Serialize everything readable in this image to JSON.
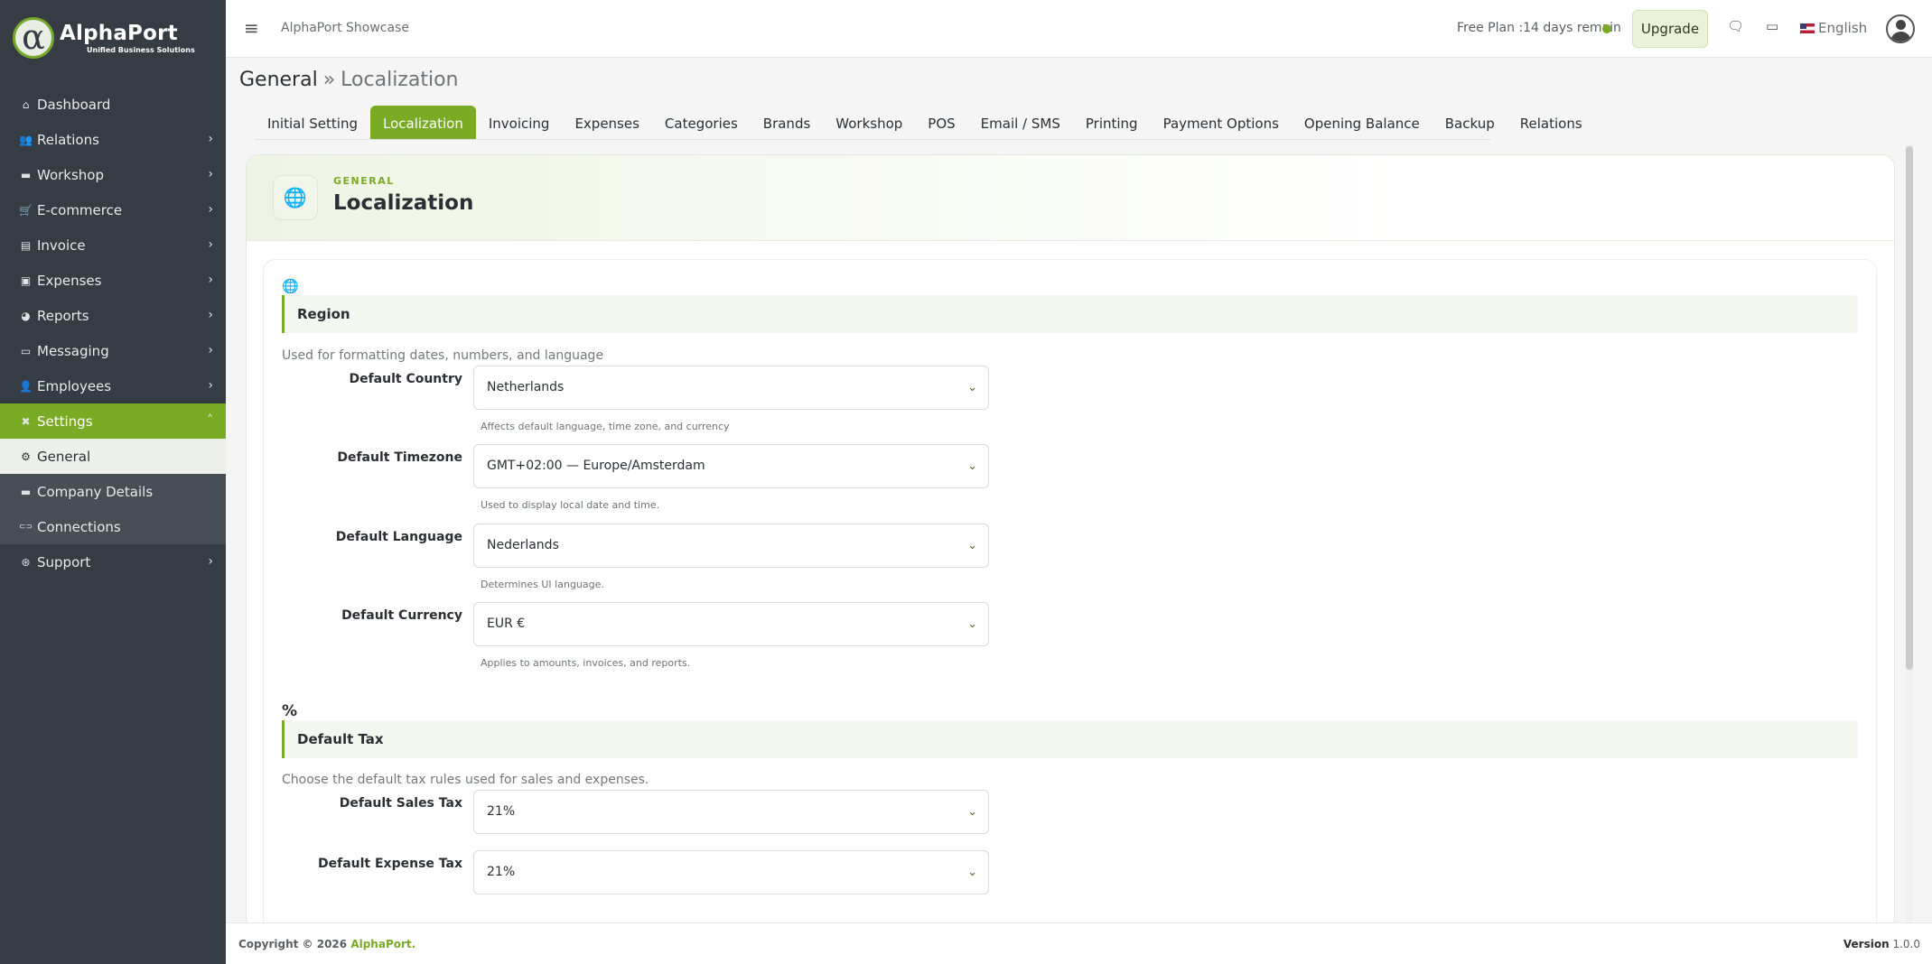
{
  "brand": {
    "title": "AlphaPort",
    "subtitle": "Unified Business Solutions",
    "mark": "α"
  },
  "sidebar": {
    "items": [
      {
        "label": "Dashboard",
        "icon": "home-icon",
        "glyph": "⌂",
        "chev": ""
      },
      {
        "label": "Relations",
        "icon": "users-icon",
        "glyph": "👥",
        "chev": "›"
      },
      {
        "label": "Workshop",
        "icon": "briefcase-icon",
        "glyph": "▬",
        "chev": "›"
      },
      {
        "label": "E-commerce",
        "icon": "cart-icon",
        "glyph": "🛒",
        "chev": "›"
      },
      {
        "label": "Invoice",
        "icon": "invoice-icon",
        "glyph": "▤",
        "chev": "›"
      },
      {
        "label": "Expenses",
        "icon": "money-icon",
        "glyph": "▣",
        "chev": "›"
      },
      {
        "label": "Reports",
        "icon": "pie-chart-icon",
        "glyph": "◕",
        "chev": "›"
      },
      {
        "label": "Messaging",
        "icon": "message-icon",
        "glyph": "▭",
        "chev": "›"
      },
      {
        "label": "Employees",
        "icon": "employees-icon",
        "glyph": "👤",
        "chev": "›"
      },
      {
        "label": "Settings",
        "icon": "tools-icon",
        "glyph": "✖",
        "chev": "˄"
      },
      {
        "label": "General",
        "icon": "gear-icon",
        "glyph": "⚙",
        "chev": ""
      },
      {
        "label": "Company Details",
        "icon": "briefcase-icon",
        "glyph": "▬",
        "chev": ""
      },
      {
        "label": "Connections",
        "icon": "link-icon",
        "glyph": "⊂⊃",
        "chev": ""
      },
      {
        "label": "Support",
        "icon": "lifebuoy-icon",
        "glyph": "⊛",
        "chev": "›"
      }
    ]
  },
  "header": {
    "app_name": "AlphaPort Showcase",
    "plan": "Free Plan :14 days remain",
    "upgrade": "Upgrade",
    "language": "English",
    "menu_glyph": "≡",
    "chat_glyph": "🗨",
    "card_glyph": "▭"
  },
  "breadcrumb": {
    "parent": "General",
    "sep": "»",
    "current": "Localization"
  },
  "tabs": [
    "Initial Setting",
    "Localization",
    "Invoicing",
    "Expenses",
    "Categories",
    "Brands",
    "Workshop",
    "POS",
    "Email / SMS",
    "Printing",
    "Payment Options",
    "Opening Balance",
    "Backup",
    "Relations"
  ],
  "card": {
    "eyebrow": "GENERAL",
    "title": "Localization",
    "icon_glyph": "🌐"
  },
  "region": {
    "icon_glyph": "🌐",
    "title": "Region",
    "desc": "Used for formatting dates, numbers, and language",
    "fields": [
      {
        "label": "Default Country",
        "value": "Netherlands",
        "help": "Affects default language, time zone, and currency"
      },
      {
        "label": "Default Timezone",
        "value": "GMT+02:00 — Europe/Amsterdam",
        "help": "Used to display local date and time."
      },
      {
        "label": "Default Language",
        "value": "Nederlands",
        "help": "Determines UI language."
      },
      {
        "label": "Default Currency",
        "value": "EUR  €",
        "help": "Applies to amounts, invoices, and reports."
      }
    ]
  },
  "tax": {
    "icon_glyph": "%",
    "title": "Default Tax",
    "desc": "Choose the default tax rules used for sales and expenses.",
    "fields": [
      {
        "label": "Default Sales Tax",
        "value": "21%"
      },
      {
        "label": "Default Expense Tax",
        "value": "21%"
      }
    ]
  },
  "caret_glyph": "⌄",
  "footer": {
    "copy_prefix": "Copyright © 2026",
    "copy_brand": "AlphaPort.",
    "version_label": "Version",
    "version": "1.0.0"
  },
  "colors": {
    "accent": "#7aab24",
    "sidebar": "#353c43",
    "sub_item": "#474e55"
  }
}
